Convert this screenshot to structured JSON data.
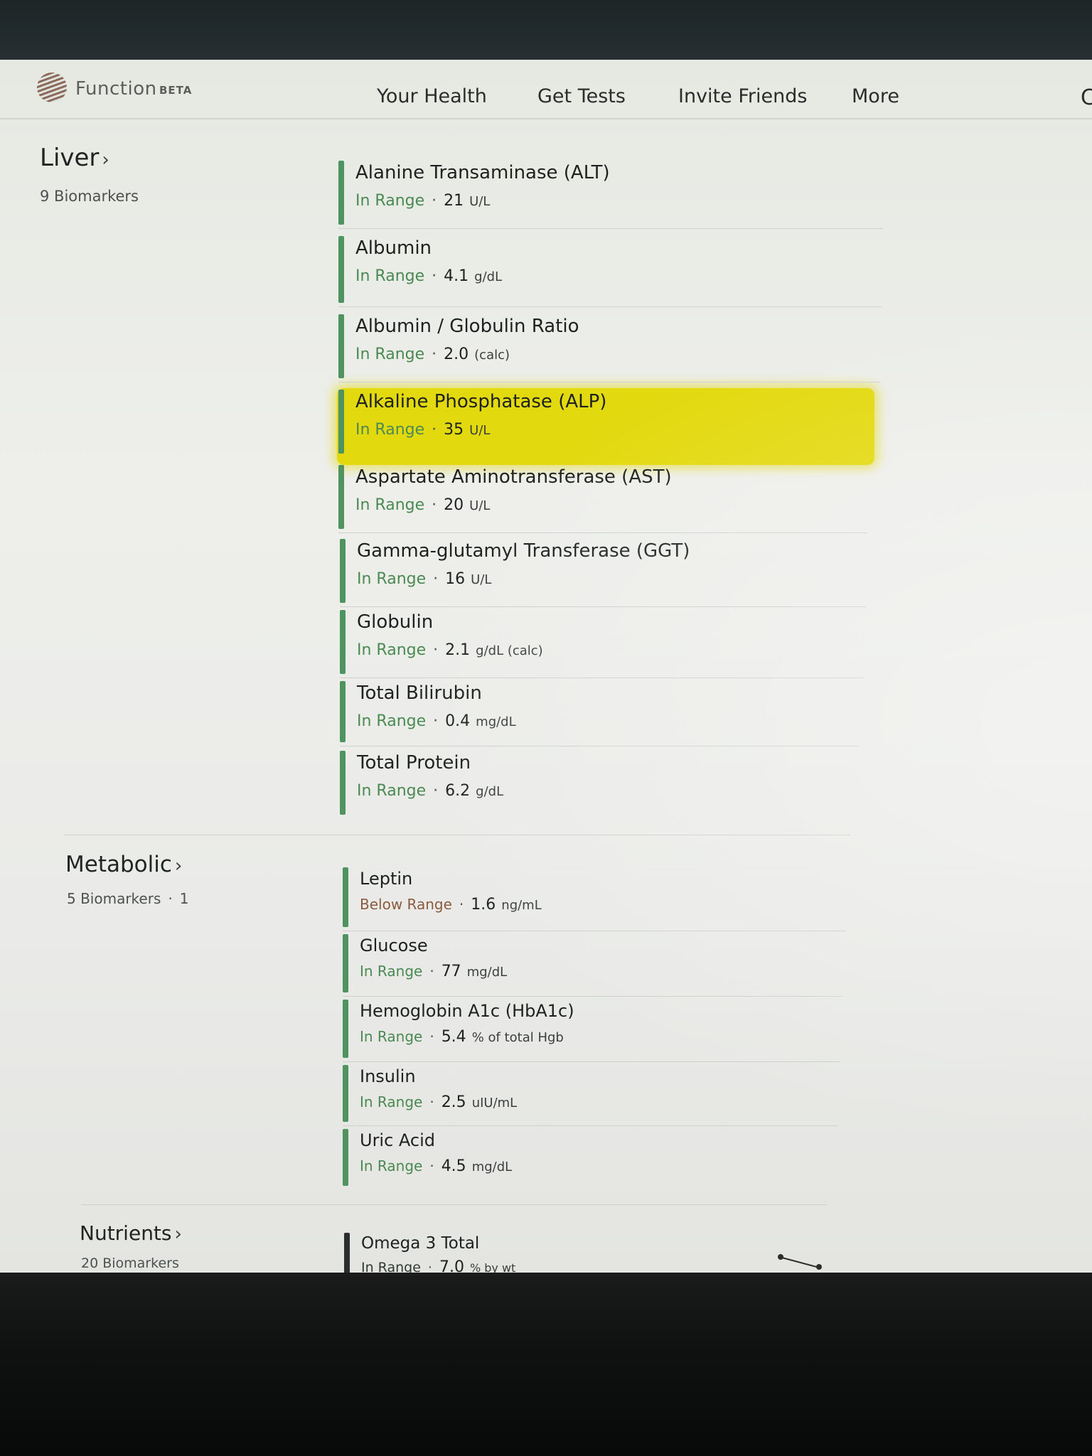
{
  "header": {
    "brand": "Function",
    "beta": "BETA",
    "nav": [
      "Your Health",
      "Get Tests",
      "Invite Friends",
      "More"
    ]
  },
  "groups": [
    {
      "title": "Liver",
      "chevron": "›",
      "count": "9 Biomarkers",
      "items": [
        {
          "name": "Alanine Transaminase (ALT)",
          "status": "In Range",
          "value": "21",
          "unit": "U/L"
        },
        {
          "name": "Albumin",
          "status": "In Range",
          "value": "4.1",
          "unit": "g/dL"
        },
        {
          "name": "Albumin / Globulin Ratio",
          "status": "In Range",
          "value": "2.0",
          "unit": "(calc)"
        },
        {
          "name": "Alkaline Phosphatase (ALP)",
          "status": "In Range",
          "value": "35",
          "unit": "U/L",
          "highlighted": true
        },
        {
          "name": "Aspartate Aminotransferase (AST)",
          "status": "In Range",
          "value": "20",
          "unit": "U/L"
        },
        {
          "name": "Gamma-glutamyl Transferase (GGT)",
          "status": "In Range",
          "value": "16",
          "unit": "U/L"
        },
        {
          "name": "Globulin",
          "status": "In Range",
          "value": "2.1",
          "unit": "g/dL (calc)"
        },
        {
          "name": "Total Bilirubin",
          "status": "In Range",
          "value": "0.4",
          "unit": "mg/dL"
        },
        {
          "name": "Total Protein",
          "status": "In Range",
          "value": "6.2",
          "unit": "g/dL"
        }
      ]
    },
    {
      "title": "Metabolic",
      "chevron": "›",
      "count": "5 Biomarkers",
      "flag_count": "1",
      "items": [
        {
          "name": "Leptin",
          "status": "Below Range",
          "value": "1.6",
          "unit": "ng/mL"
        },
        {
          "name": "Glucose",
          "status": "In Range",
          "value": "77",
          "unit": "mg/dL"
        },
        {
          "name": "Hemoglobin A1c (HbA1c)",
          "status": "In Range",
          "value": "5.4",
          "unit": "% of total Hgb"
        },
        {
          "name": "Insulin",
          "status": "In Range",
          "value": "2.5",
          "unit": "uIU/mL"
        },
        {
          "name": "Uric Acid",
          "status": "In Range",
          "value": "4.5",
          "unit": "mg/dL"
        }
      ]
    },
    {
      "title": "Nutrients",
      "chevron": "›",
      "count": "20 Biomarkers",
      "items": [
        {
          "name": "Omega 3 Total",
          "status": "In Range",
          "value": "7.0",
          "unit": "% by wt"
        }
      ]
    }
  ],
  "colors": {
    "in_range": "#4a8a52",
    "below_range": "#8c5a3e",
    "highlight": "#e3d90f"
  }
}
